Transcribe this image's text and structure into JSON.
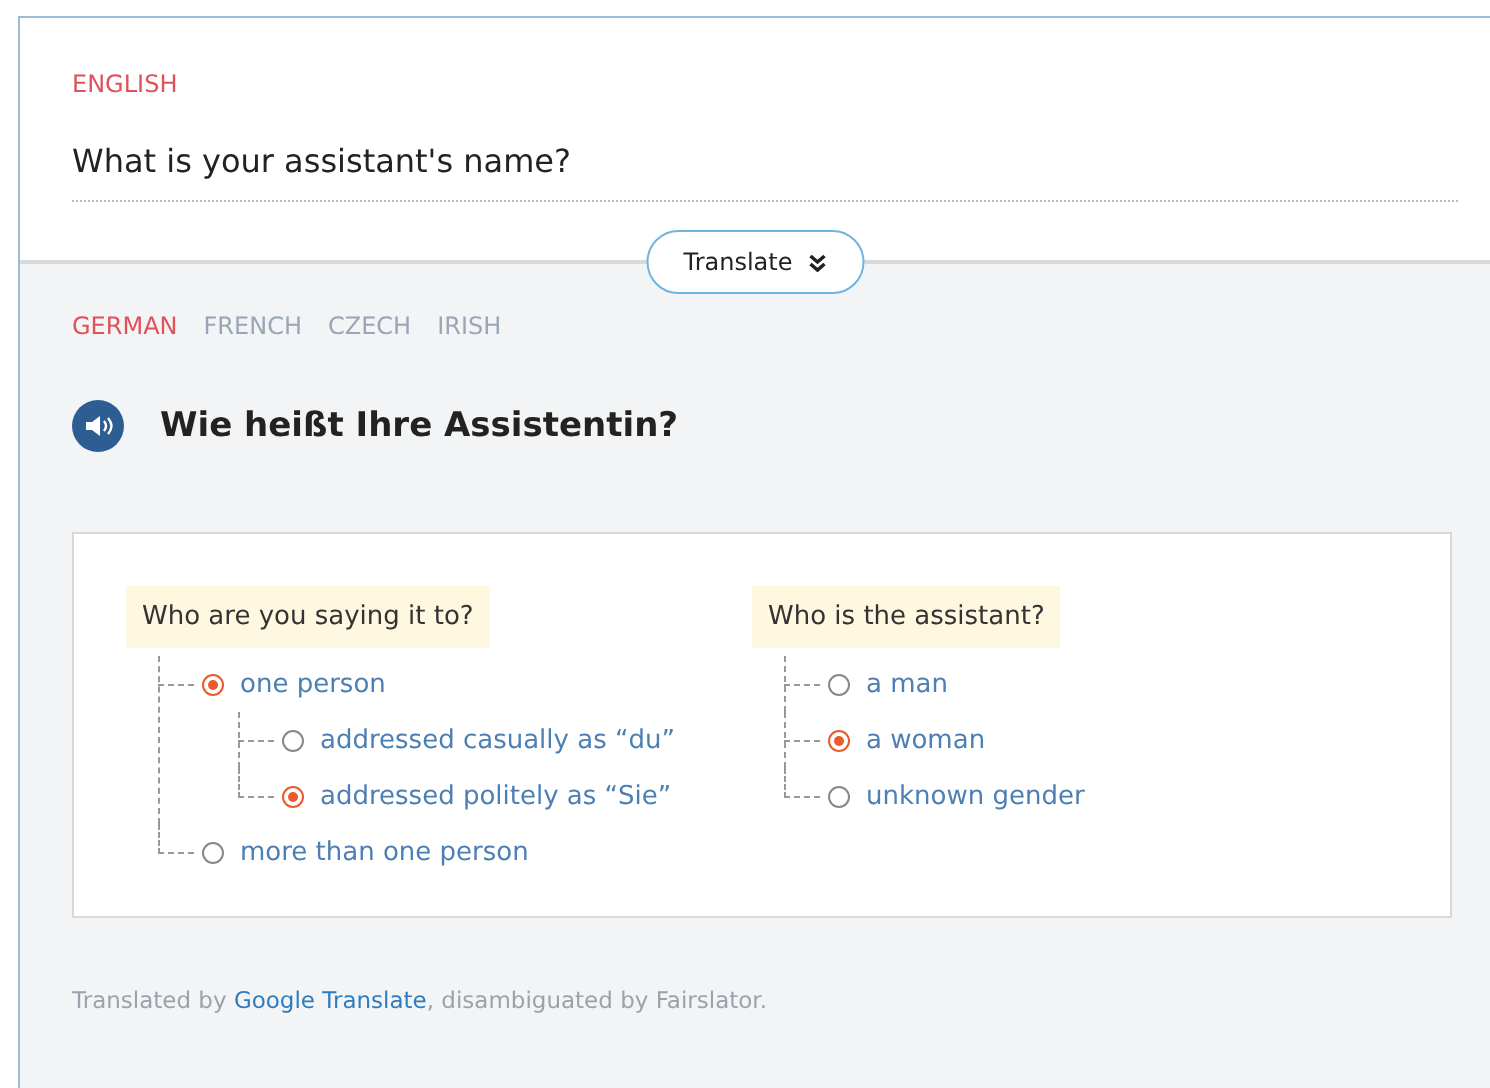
{
  "source": {
    "language": "ENGLISH",
    "value": "What is your assistant's name?"
  },
  "translate_button": {
    "label": "Translate"
  },
  "target_languages": [
    {
      "label": "GERMAN",
      "selected": true
    },
    {
      "label": "FRENCH",
      "selected": false
    },
    {
      "label": "CZECH",
      "selected": false
    },
    {
      "label": "IRISH",
      "selected": false
    }
  ],
  "translation": "Wie heißt Ihre Assistentin?",
  "questions": [
    {
      "label": "Who are you saying it to?",
      "options": [
        {
          "label": "one person",
          "selected": true,
          "children": [
            {
              "label": "addressed casually as “du”",
              "selected": false
            },
            {
              "label": "addressed politely as “Sie”",
              "selected": true
            }
          ]
        },
        {
          "label": "more than one person",
          "selected": false
        }
      ]
    },
    {
      "label": "Who is the assistant?",
      "options": [
        {
          "label": "a man",
          "selected": false
        },
        {
          "label": "a woman",
          "selected": true
        },
        {
          "label": "unknown gender",
          "selected": false
        }
      ]
    }
  ],
  "footer": {
    "prefix": "Translated by ",
    "link": "Google Translate",
    "suffix": ", disambiguated by Fairslator."
  }
}
